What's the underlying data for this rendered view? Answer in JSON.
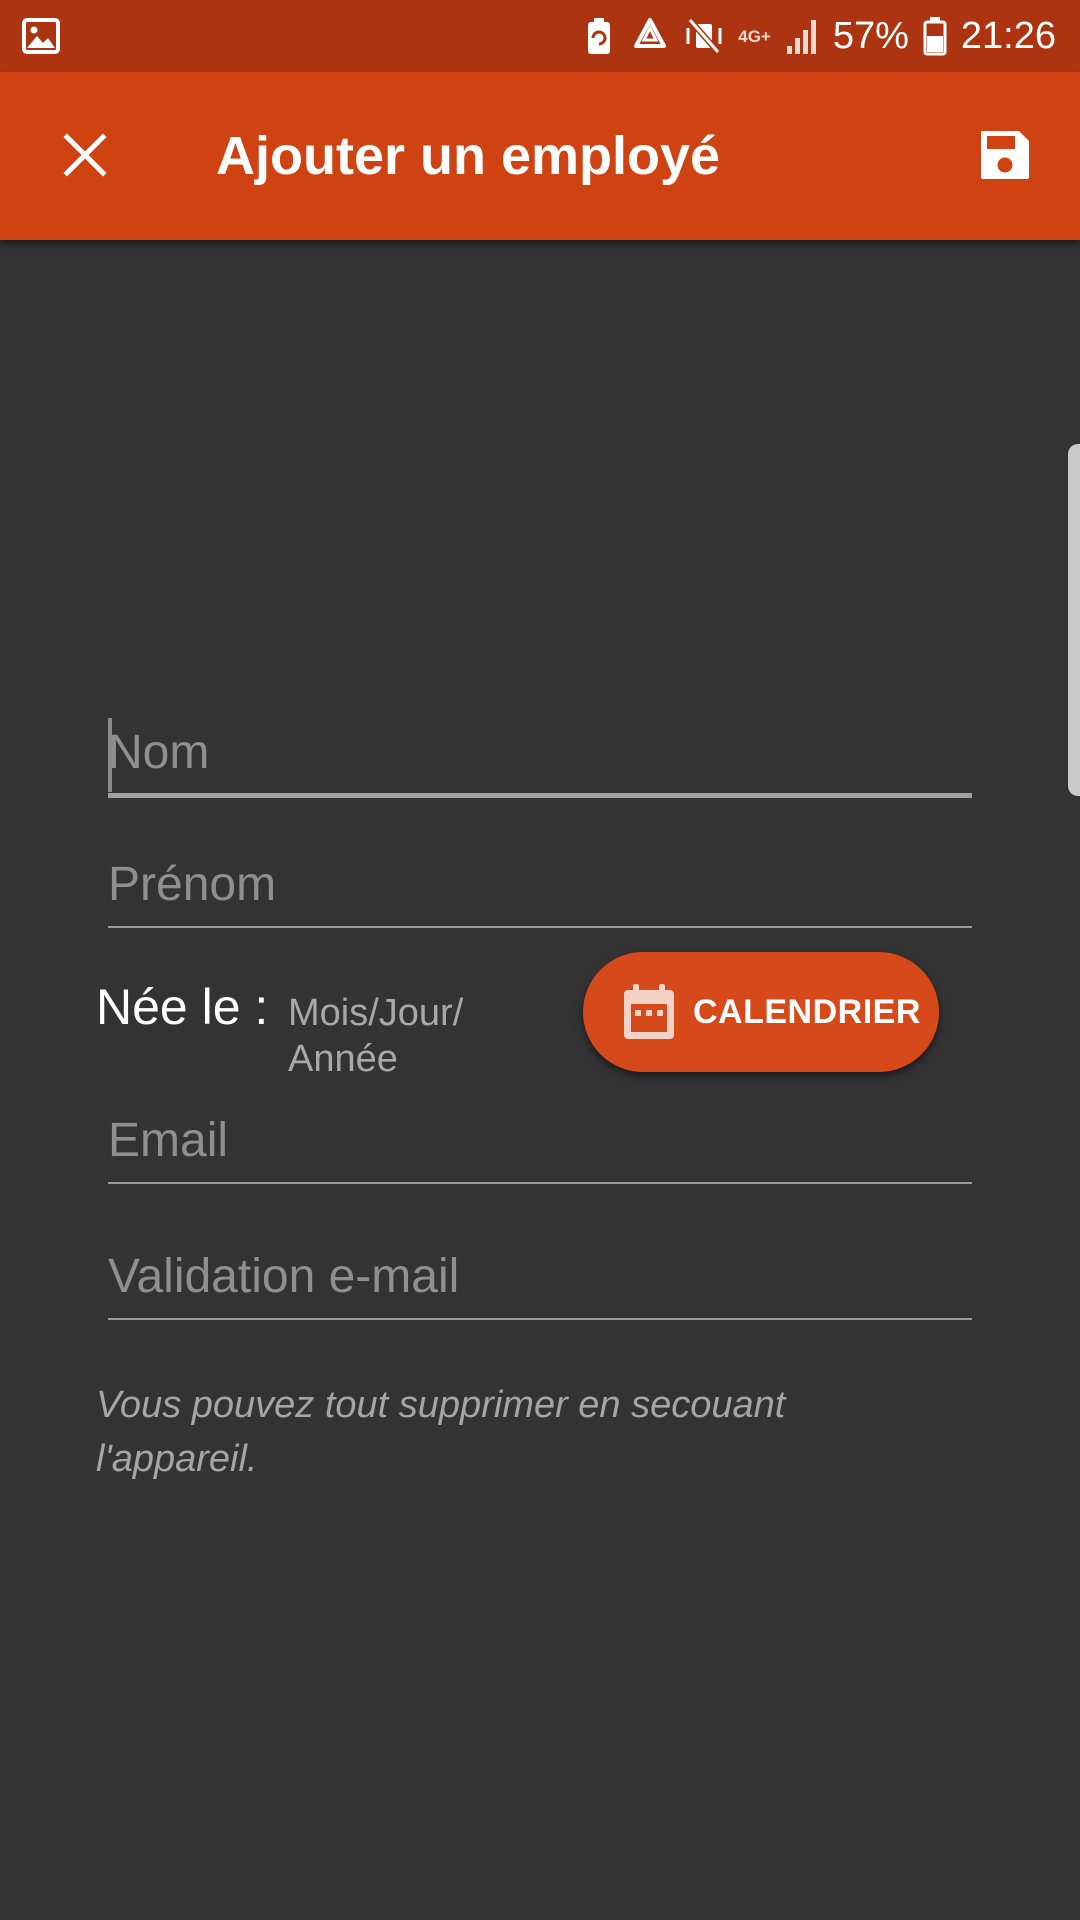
{
  "status_bar": {
    "network": "4G+",
    "battery": "57%",
    "time": "21:26"
  },
  "app_bar": {
    "title": "Ajouter un employé",
    "close_icon": "close-icon",
    "save_icon": "floppy-disk-save-icon"
  },
  "form": {
    "nom": {
      "placeholder": "Nom",
      "value": ""
    },
    "prenom": {
      "placeholder": "Prénom",
      "value": ""
    },
    "birth": {
      "label": "Née le :",
      "value": "Mois/Jour/ Année",
      "button_label": "CALENDRIER",
      "button_icon": "calendar-icon"
    },
    "email": {
      "placeholder": "Email",
      "value": ""
    },
    "email_validation": {
      "placeholder": "Validation e-mail",
      "value": ""
    },
    "hint": "Vous pouvez tout supprimer en secouant l'appareil."
  },
  "colors": {
    "status_bar": "#ad3411",
    "app_bar": "#cf4212",
    "background": "#333333",
    "accent_button": "#d5491a"
  }
}
